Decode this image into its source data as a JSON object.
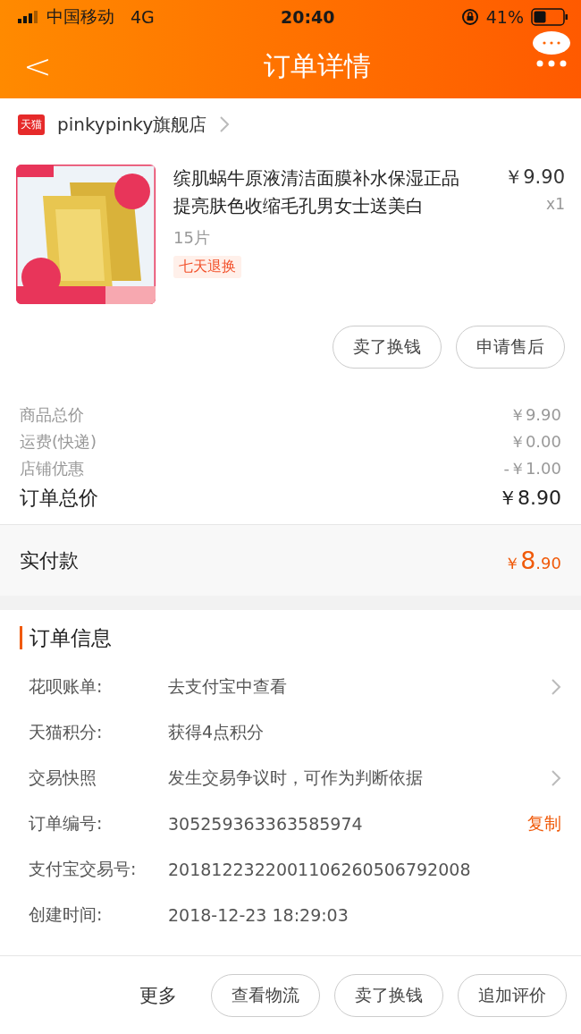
{
  "status_bar": {
    "carrier": "中国移动",
    "network": "4G",
    "time": "20:40",
    "battery": "41%"
  },
  "nav": {
    "back": "<",
    "title": "订单详情"
  },
  "store": {
    "badge": "天猫",
    "name": "pinkypinky旗舰店"
  },
  "product": {
    "title": "缤肌蜗牛原液清洁面膜补水保湿正品提亮肤色收缩毛孔男女士送美白",
    "spec": "15片",
    "tag": "七天退换",
    "price": "￥9.90",
    "quantity": "x1"
  },
  "product_actions": [
    "卖了换钱",
    "申请售后"
  ],
  "costs": [
    {
      "kind": "minor",
      "label": "商品总价",
      "value": "￥9.90"
    },
    {
      "kind": "minor",
      "label": "运费(快递)",
      "value": "￥0.00"
    },
    {
      "kind": "minor",
      "label": "店铺优惠",
      "value": "-￥1.00"
    },
    {
      "kind": "total",
      "label": "订单总价",
      "value": "￥8.90"
    }
  ],
  "paid": {
    "label": "实付款",
    "currency": "￥",
    "major": "8",
    "minor": ".90"
  },
  "order_info": {
    "title": "订单信息",
    "rows": [
      {
        "label": "花呗账单:",
        "value": "去支付宝中查看",
        "chevron": true
      },
      {
        "label": "天猫积分:",
        "value": "获得4点积分",
        "chevron": false
      },
      {
        "label": "交易快照",
        "value": "发生交易争议时，可作为判断依据",
        "chevron": true
      },
      {
        "label": "订单编号:",
        "value": "305259363363585974",
        "chevron": false,
        "action": "复制"
      },
      {
        "label": "支付宝交易号:",
        "value": "2018122322001106260506792008",
        "chevron": false
      },
      {
        "label": "创建时间:",
        "value": "2018-12-23 18:29:03",
        "chevron": false
      }
    ]
  },
  "bottom_bar": {
    "more": "更多",
    "buttons": [
      "查看物流",
      "卖了换钱",
      "追加评价"
    ]
  }
}
